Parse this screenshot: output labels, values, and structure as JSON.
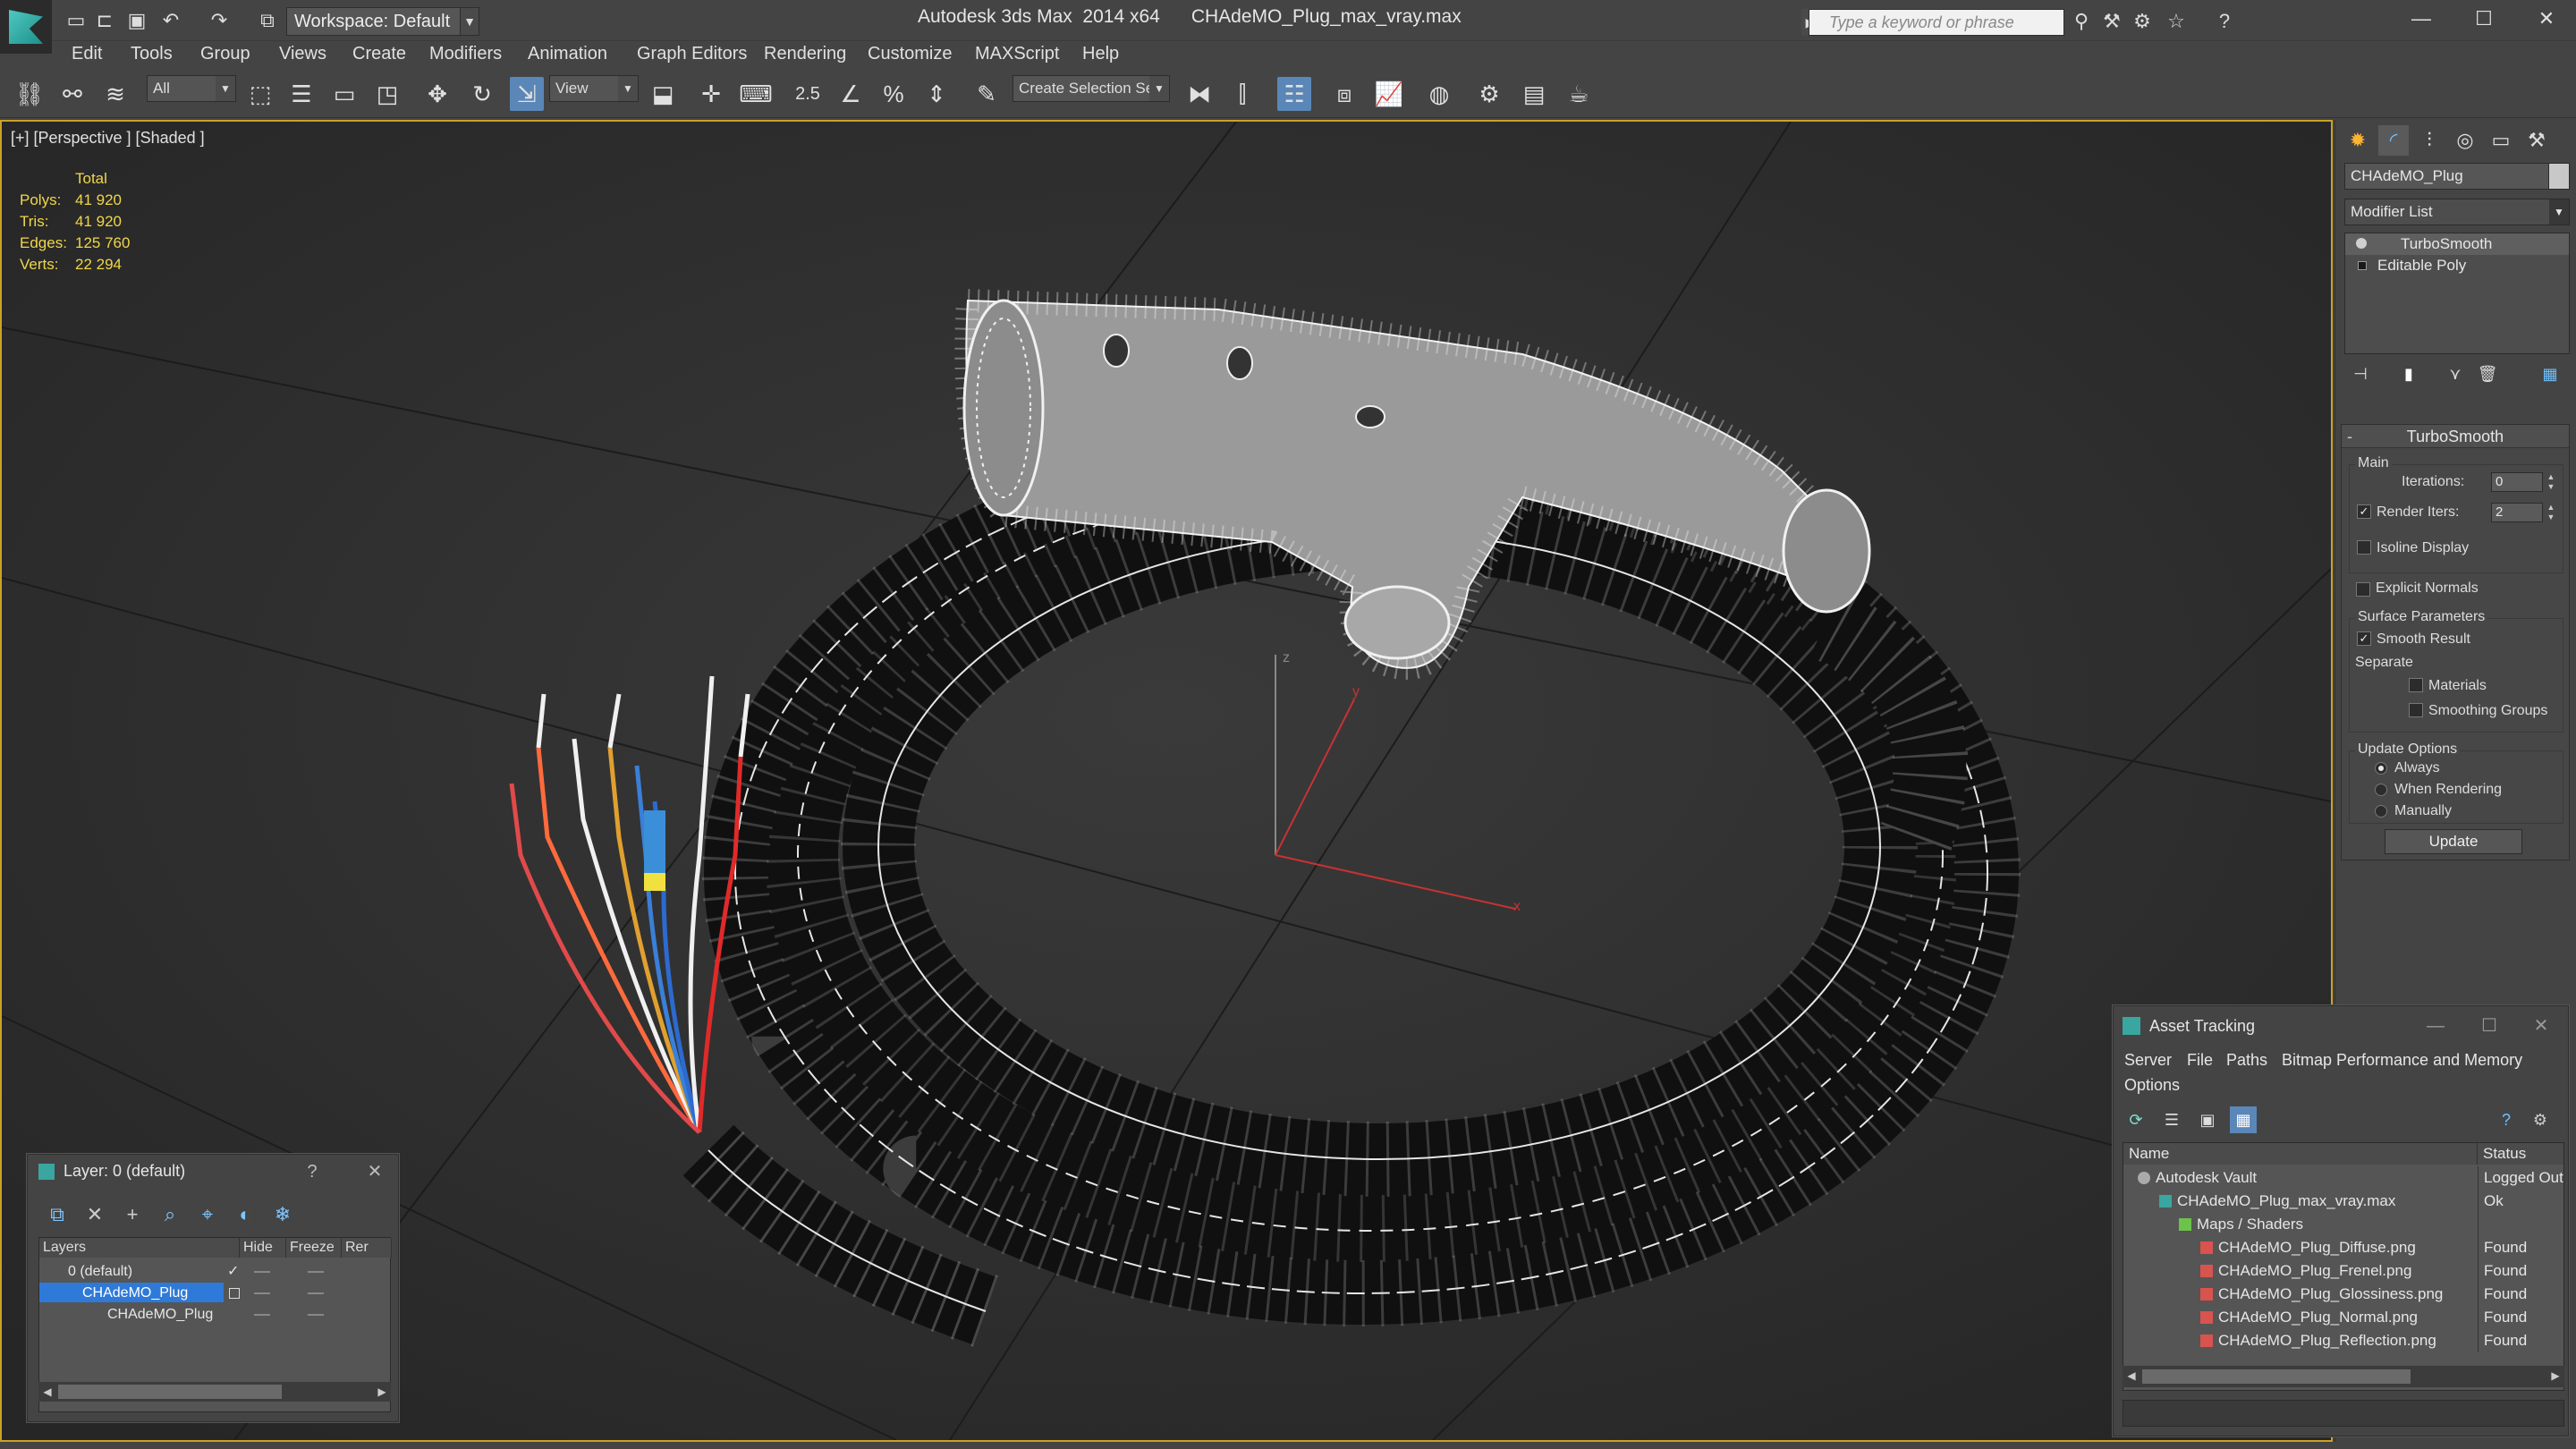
{
  "titlebar": {
    "workspace": "Workspace: Default",
    "app_title": "Autodesk 3ds Max  2014 x64      CHAdeMO_Plug_max_vray.max",
    "search_placeholder": "Type a keyword or phrase"
  },
  "menu": [
    "Edit",
    "Tools",
    "Group",
    "Views",
    "Create",
    "Modifiers",
    "Animation",
    "Graph Editors",
    "Rendering",
    "Customize",
    "MAXScript",
    "Help"
  ],
  "toolbar": {
    "selection_filter": "All",
    "ref_coord": "View",
    "snap_label": "2.5",
    "selection_set": "Create Selection Se"
  },
  "viewport": {
    "label": "[+] [Perspective ] [Shaded ]",
    "stats": {
      "header": "Total",
      "rows": [
        {
          "label": "Polys:",
          "value": "41 920"
        },
        {
          "label": "Tris:",
          "value": "41 920"
        },
        {
          "label": "Edges:",
          "value": "125 760"
        },
        {
          "label": "Verts:",
          "value": "22 294"
        }
      ]
    },
    "axis_labels": {
      "x": "x",
      "y": "y",
      "z": "z"
    }
  },
  "command_panel": {
    "object_name": "CHAdeMO_Plug",
    "modifier_list": "Modifier List",
    "stack": [
      "TurboSmooth",
      "Editable Poly"
    ],
    "rollout_title": "TurboSmooth",
    "main_group": "Main",
    "iterations_label": "Iterations:",
    "iterations_value": "0",
    "render_iters_label": "Render Iters:",
    "render_iters_value": "2",
    "isoline_display": "Isoline Display",
    "explicit_normals": "Explicit Normals",
    "surface_params": "Surface Parameters",
    "smooth_result": "Smooth Result",
    "separate": "Separate",
    "materials": "Materials",
    "smoothing_groups": "Smoothing Groups",
    "update_options": "Update Options",
    "always": "Always",
    "when_rendering": "When Rendering",
    "manually": "Manually",
    "update_button": "Update"
  },
  "layer_panel": {
    "title": "Layer: 0 (default)",
    "help": "?",
    "close": "✕",
    "columns": [
      "Layers",
      "Hide",
      "Freeze",
      "Rer"
    ],
    "rows": [
      {
        "name": "0 (default)",
        "check": "✓"
      },
      {
        "name": "CHAdeMO_Plug",
        "check": ""
      },
      {
        "name": "CHAdeMO_Plug",
        "check": ""
      }
    ]
  },
  "asset_panel": {
    "title": "Asset Tracking",
    "menu": [
      "Server",
      "File",
      "Paths",
      "Bitmap Performance and Memory",
      "Options"
    ],
    "columns": [
      "Name",
      "Status"
    ],
    "rows": [
      {
        "name": "Autodesk Vault",
        "status": "Logged Out"
      },
      {
        "name": "CHAdeMO_Plug_max_vray.max",
        "status": "Ok"
      },
      {
        "name": "Maps / Shaders",
        "status": ""
      },
      {
        "name": "CHAdeMO_Plug_Diffuse.png",
        "status": "Found"
      },
      {
        "name": "CHAdeMO_Plug_Frenel.png",
        "status": "Found"
      },
      {
        "name": "CHAdeMO_Plug_Glossiness.png",
        "status": "Found"
      },
      {
        "name": "CHAdeMO_Plug_Normal.png",
        "status": "Found"
      },
      {
        "name": "CHAdeMO_Plug_Reflection.png",
        "status": "Found"
      }
    ]
  },
  "colors": {
    "accent": "#5b87b8",
    "viewport_border": "#c9a227",
    "stats_text": "#f0d64a",
    "selection": "#2f7ad8"
  }
}
